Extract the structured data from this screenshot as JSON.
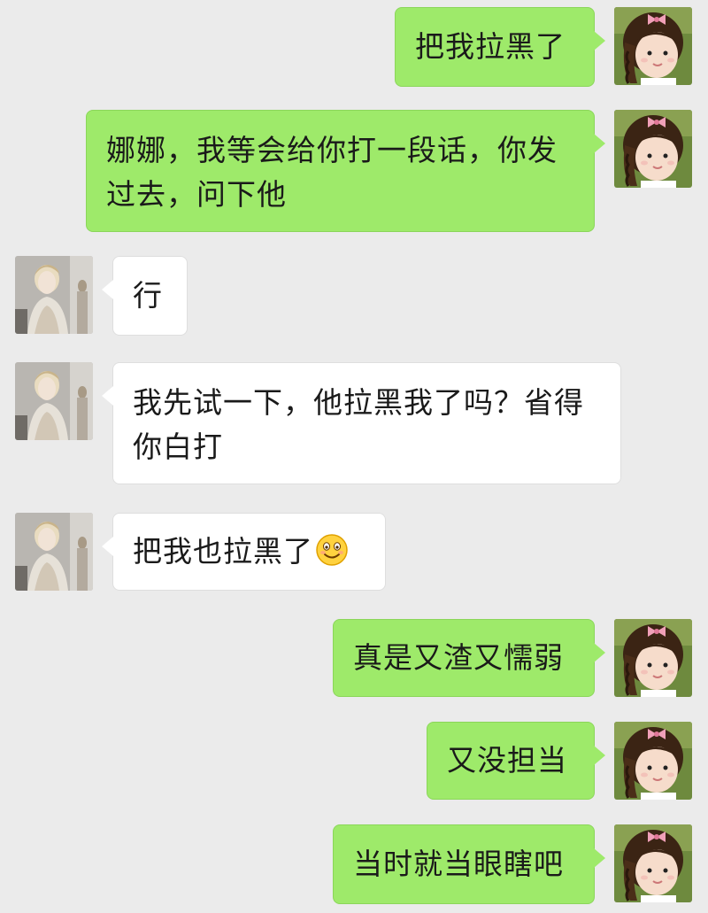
{
  "messages": [
    {
      "sender": "me",
      "text": "把我拉黑了"
    },
    {
      "sender": "me",
      "text": "娜娜，我等会给你打一段话，你发过去，问下他"
    },
    {
      "sender": "friend",
      "text": "行"
    },
    {
      "sender": "friend",
      "text": "我先试一下，他拉黑我了吗？省得你白打"
    },
    {
      "sender": "friend",
      "text": "把我也拉黑了",
      "emoji": "smile-emoji"
    },
    {
      "sender": "me",
      "text": "真是又渣又懦弱"
    },
    {
      "sender": "me",
      "text": "又没担当"
    },
    {
      "sender": "me",
      "text": "当时就当眼瞎吧"
    }
  ],
  "colors": {
    "background": "#ebebeb",
    "sent_bubble": "#9eea6a",
    "received_bubble": "#ffffff"
  }
}
